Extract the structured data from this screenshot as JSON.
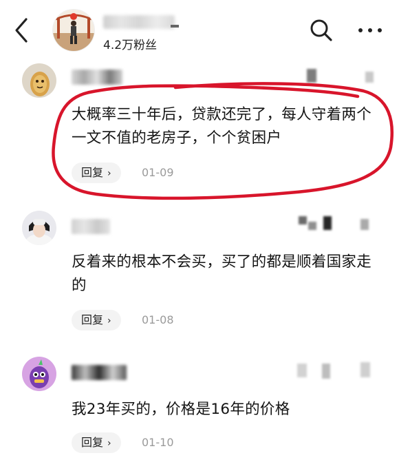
{
  "header": {
    "fans_label": "4.2万粉丝"
  },
  "comments": [
    {
      "text": "大概率三十年后，贷款还完了，每人守着两个一文不值的老房子，个个贫困户",
      "reply_label": "回复",
      "date": "01-09"
    },
    {
      "text": "反着来的根本不会买，买了的都是顺着国家走的",
      "reply_label": "回复",
      "date": "01-08"
    },
    {
      "text": "我23年买的，价格是16年的价格",
      "reply_label": "回复",
      "date": "01-10"
    }
  ],
  "icons": [
    "back-arrow-icon",
    "search-icon",
    "more-icon",
    "chevron-right-icon"
  ],
  "colors": {
    "annotation": "#d8152b",
    "reply_bg": "#f3f3f3",
    "date": "#9a9a9a"
  }
}
